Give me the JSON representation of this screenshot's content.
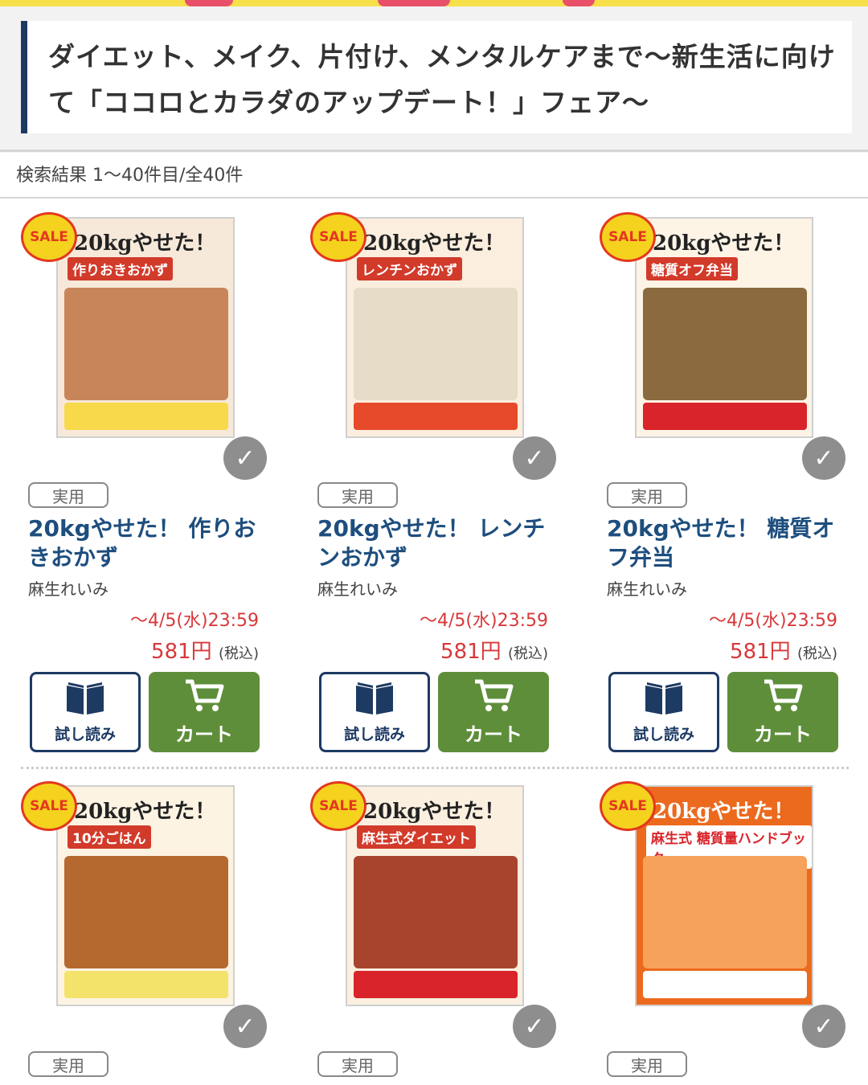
{
  "page": {
    "headline": "ダイエット、メイク、片付け、メンタルケアまで〜新生活に向けて「ココロとカラダのアップデート！」フェア〜",
    "result_count": "検索結果 1〜40件目/全40件"
  },
  "colors": {
    "accent_navy": "#1d3a63",
    "title_blue": "#1d4e7e",
    "price_red": "#d8383a",
    "cart_green": "#5e8e3a",
    "sale_yellow": "#f4d21e"
  },
  "labels": {
    "sale": "SALE",
    "category": "実用",
    "trial": "試し読み",
    "cart": "カート",
    "tax": "(税込)"
  },
  "books": [
    {
      "title": "20kgやせた！ 作りおきおかず",
      "author": "麻生れいみ",
      "deadline": "〜4/5(水)23:59",
      "price": "581円",
      "cover_title": "20kgやせた！",
      "cover_subtitle": "作りおきおかず"
    },
    {
      "title": "20kgやせた！ レンチンおかず",
      "author": "麻生れいみ",
      "deadline": "〜4/5(水)23:59",
      "price": "581円",
      "cover_title": "20kgやせた！",
      "cover_subtitle": "レンチンおかず"
    },
    {
      "title": "20kgやせた！ 糖質オフ弁当",
      "author": "麻生れいみ",
      "deadline": "〜4/5(水)23:59",
      "price": "581円",
      "cover_title": "20kgやせた！",
      "cover_subtitle": "糖質オフ弁当"
    },
    {
      "cover_title": "20kgやせた！",
      "cover_subtitle": "10分ごはん"
    },
    {
      "cover_title": "20kgやせた！",
      "cover_subtitle": "麻生式ダイエット"
    },
    {
      "cover_title": "20kgやせた！",
      "cover_subtitle": "麻生式 糖質量ハンドブック"
    }
  ]
}
